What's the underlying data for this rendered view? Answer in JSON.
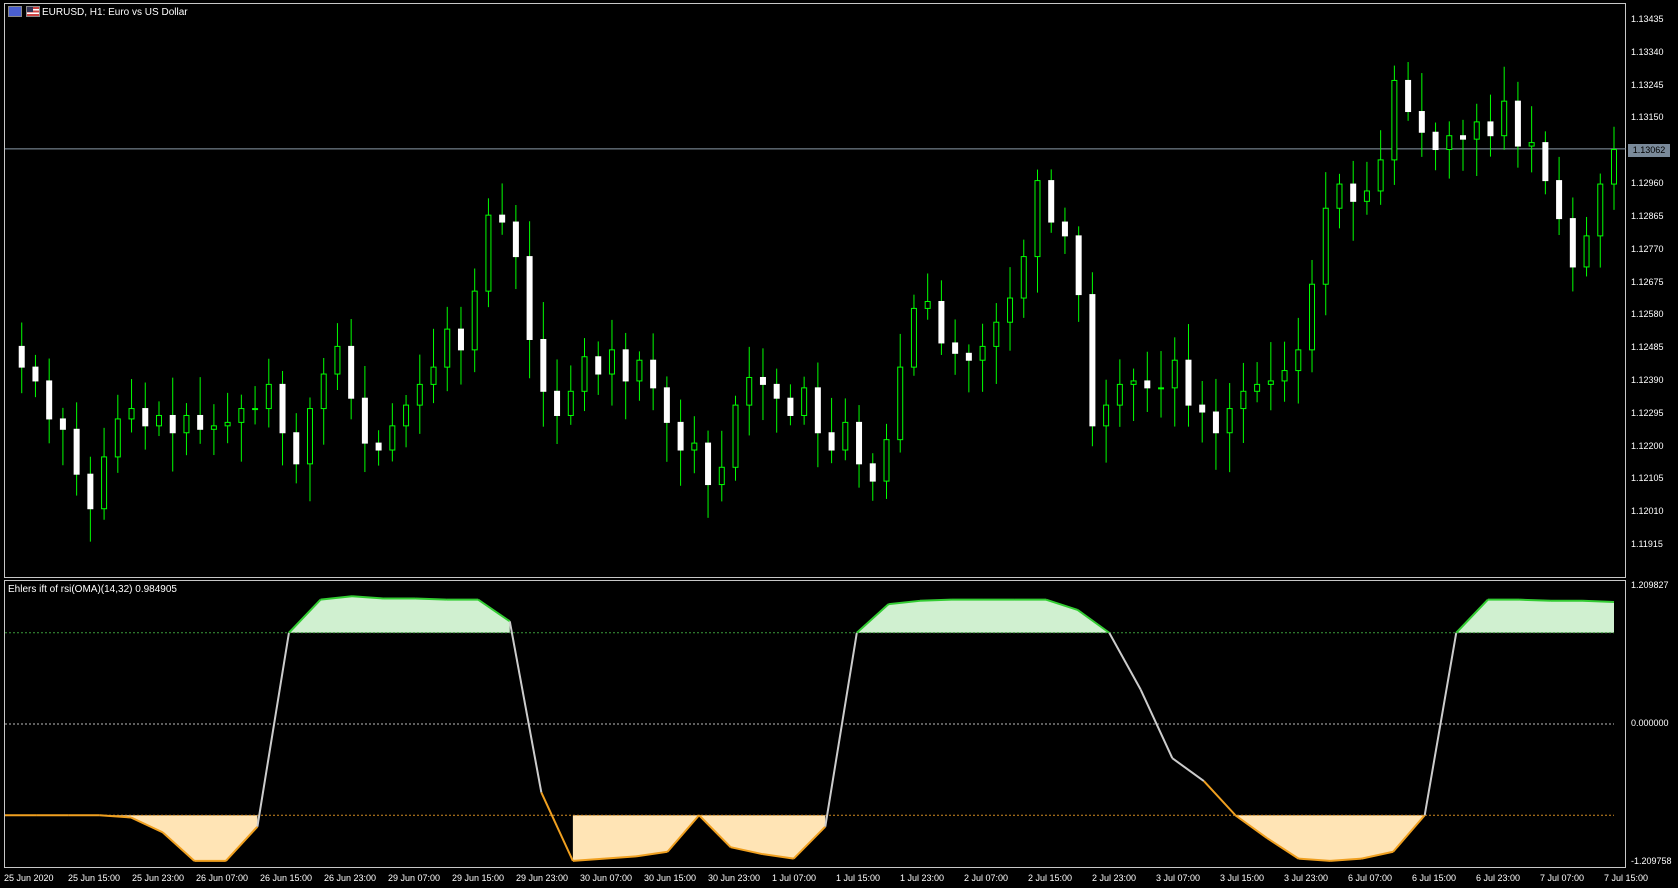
{
  "chart": {
    "title": "EURUSD, H1:  Euro vs US Dollar",
    "current_price": "1.13062",
    "y_labels": [
      "1.13435",
      "1.13340",
      "1.13245",
      "1.13150",
      "1.12960",
      "1.12865",
      "1.12770",
      "1.12675",
      "1.12580",
      "1.12485",
      "1.12390",
      "1.12295",
      "1.12200",
      "1.12105",
      "1.12010",
      "1.11915"
    ]
  },
  "indicator": {
    "title": "Ehlers ift of rsi(OMA)(14,32) 0.984905",
    "y_labels": [
      "1.209827",
      "0.000000",
      "-1.209758"
    ]
  },
  "x_labels": [
    "25 Jun 2020",
    "25 Jun 15:00",
    "25 Jun 23:00",
    "26 Jun 07:00",
    "26 Jun 15:00",
    "26 Jun 23:00",
    "29 Jun 07:00",
    "29 Jun 15:00",
    "29 Jun 23:00",
    "30 Jun 07:00",
    "30 Jun 15:00",
    "30 Jun 23:00",
    "1 Jul 07:00",
    "1 Jul 15:00",
    "1 Jul 23:00",
    "2 Jul 07:00",
    "2 Jul 15:00",
    "2 Jul 23:00",
    "3 Jul 07:00",
    "3 Jul 15:00",
    "3 Jul 23:00",
    "6 Jul 07:00",
    "6 Jul 15:00",
    "6 Jul 23:00",
    "7 Jul 07:00",
    "7 Jul 15:00"
  ],
  "colors": {
    "bull": "#00ff00",
    "bear": "#ffffff",
    "upper_fill": "#d0f0d0",
    "lower_fill": "#ffe4b5",
    "grid": "#c8c8c8",
    "price_line": "#8a9aa8"
  },
  "chart_data": [
    {
      "type": "candlestick",
      "title": "EURUSD, H1:  Euro vs US Dollar",
      "ylim": [
        1.11915,
        1.13435
      ],
      "close_path": [
        1.1249,
        1.1243,
        1.1239,
        1.1228,
        1.1225,
        1.1212,
        1.1202,
        1.1217,
        1.1228,
        1.1231,
        1.1226,
        1.1229,
        1.1224,
        1.1229,
        1.1225,
        1.1226,
        1.1227,
        1.1231,
        1.1231,
        1.1238,
        1.1224,
        1.1215,
        1.1231,
        1.1241,
        1.1249,
        1.1234,
        1.1221,
        1.1219,
        1.1226,
        1.1232,
        1.1238,
        1.1243,
        1.1254,
        1.1248,
        1.1265,
        1.1287,
        1.1285,
        1.1275,
        1.1251,
        1.1236,
        1.1229,
        1.1236,
        1.1246,
        1.1241,
        1.1248,
        1.1239,
        1.1245,
        1.1237,
        1.1227,
        1.1219,
        1.1221,
        1.1209,
        1.1214,
        1.1232,
        1.124,
        1.1238,
        1.1234,
        1.1229,
        1.1237,
        1.1224,
        1.1219,
        1.1227,
        1.1215,
        1.121,
        1.1222,
        1.1243,
        1.126,
        1.1262,
        1.125,
        1.1247,
        1.1245,
        1.1249,
        1.1256,
        1.1263,
        1.1275,
        1.1297,
        1.1285,
        1.1281,
        1.1264,
        1.1226,
        1.1232,
        1.1238,
        1.1239,
        1.1237,
        1.1237,
        1.1245,
        1.1232,
        1.123,
        1.1224,
        1.1231,
        1.1236,
        1.1238,
        1.1239,
        1.1242,
        1.1248,
        1.1267,
        1.1289,
        1.1296,
        1.1291,
        1.1294,
        1.1303,
        1.1326,
        1.1317,
        1.1311,
        1.1306,
        1.131,
        1.1309,
        1.1314,
        1.131,
        1.132,
        1.1307,
        1.1308,
        1.1297,
        1.1286,
        1.1272,
        1.1281,
        1.1296,
        1.1306
      ]
    },
    {
      "type": "line",
      "title": "Ehlers ift of rsi(OMA)(14,32) 0.984905",
      "ylim": [
        -1.209758,
        1.209827
      ],
      "levels": [
        0.8,
        0.0,
        -0.8
      ],
      "ift_path": [
        -0.8,
        -0.8,
        -0.8,
        -0.8,
        -0.82,
        -0.95,
        -1.2,
        -1.2,
        -0.9,
        0.8,
        1.09,
        1.12,
        1.1,
        1.1,
        1.09,
        1.09,
        0.9,
        -0.6,
        -1.2,
        -1.18,
        -1.16,
        -1.12,
        -0.8,
        -1.08,
        -1.14,
        -1.18,
        -0.9,
        0.8,
        1.05,
        1.08,
        1.09,
        1.09,
        1.09,
        1.09,
        1.0,
        0.8,
        0.3,
        -0.3,
        -0.5,
        -0.8,
        -1.0,
        -1.18,
        -1.2,
        -1.18,
        -1.12,
        -0.8,
        0.8,
        1.09,
        1.09,
        1.08,
        1.08,
        1.07
      ]
    }
  ]
}
